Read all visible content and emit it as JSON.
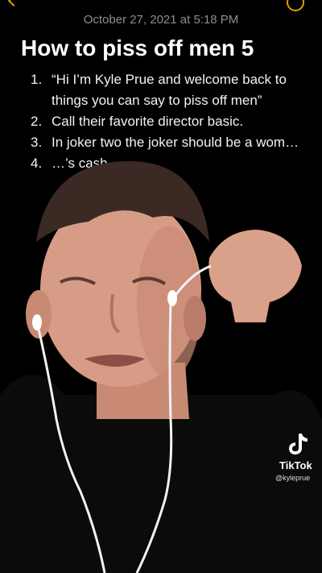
{
  "note": {
    "date": "October 27, 2021 at 5:18 PM",
    "title": "How to piss off men 5",
    "items": [
      {
        "num": "1.",
        "text": "“Hi I’m Kyle Prue and welcome back to things you can say to piss off men”"
      },
      {
        "num": "2.",
        "text": "Call their favorite director basic."
      },
      {
        "num": "3.",
        "text": "In joker two the joker should be a wom…"
      },
      {
        "num": "4.",
        "text": "…’s cash."
      }
    ]
  },
  "watermark": {
    "brand": "TikTok",
    "user": "@kyleprue",
    "icon": "tiktok-note-icon"
  }
}
